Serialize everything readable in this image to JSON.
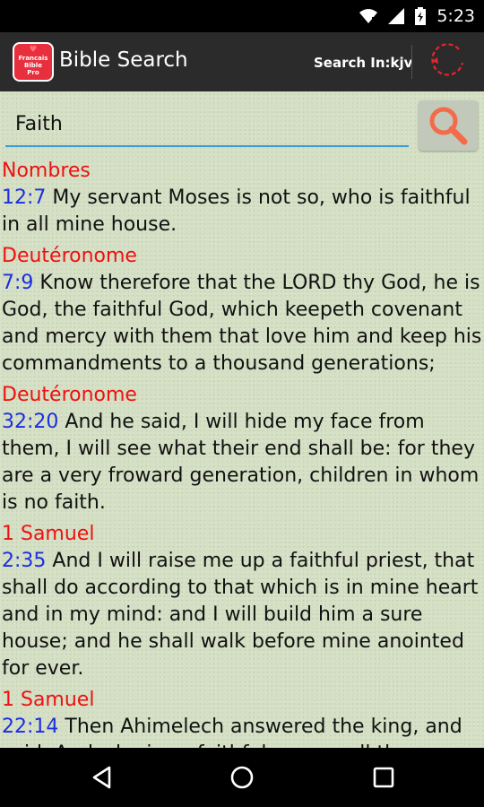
{
  "status": {
    "time": "5:23"
  },
  "app": {
    "title": "Bible Search",
    "logo_text": [
      "Francais",
      "Bible",
      "Pro"
    ],
    "search_in": "Search In:kjv"
  },
  "search": {
    "value": "Faith"
  },
  "results": [
    {
      "book": "Nombres",
      "ref": "12:7",
      "text": " My servant Moses is not so, who is faithful in all mine house."
    },
    {
      "book": "Deutéronome",
      "ref": "7:9",
      "text": " Know therefore that the LORD thy God, he is God, the faithful God, which keepeth covenant and mercy with them that love him and keep his commandments to a thousand generations;"
    },
    {
      "book": "Deutéronome",
      "ref": "32:20",
      "text": " And he said, I will hide my face from them, I will see what their end shall be: for they are a very froward generation, children in whom is no faith."
    },
    {
      "book": "1 Samuel",
      "ref": "2:35",
      "text": " And I will raise me up a faithful priest, that shall do according to that which is in mine heart and in my mind: and I will build him a sure house; and he shall walk before mine anointed for ever."
    },
    {
      "book": "1 Samuel",
      "ref": "22:14",
      "text": " Then Ahimelech answered the king, and said, And who is so faithful among all thy"
    }
  ],
  "colors": {
    "book": "#ee1111",
    "ref": "#1c2ee0",
    "background": "#d4dfc4",
    "appbar": "#2b2b2b",
    "accent": "#3b9bd6"
  },
  "icons": {
    "search": "search-icon",
    "refresh": "refresh-icon",
    "back": "back-icon",
    "home": "home-icon",
    "recents": "recents-icon"
  }
}
